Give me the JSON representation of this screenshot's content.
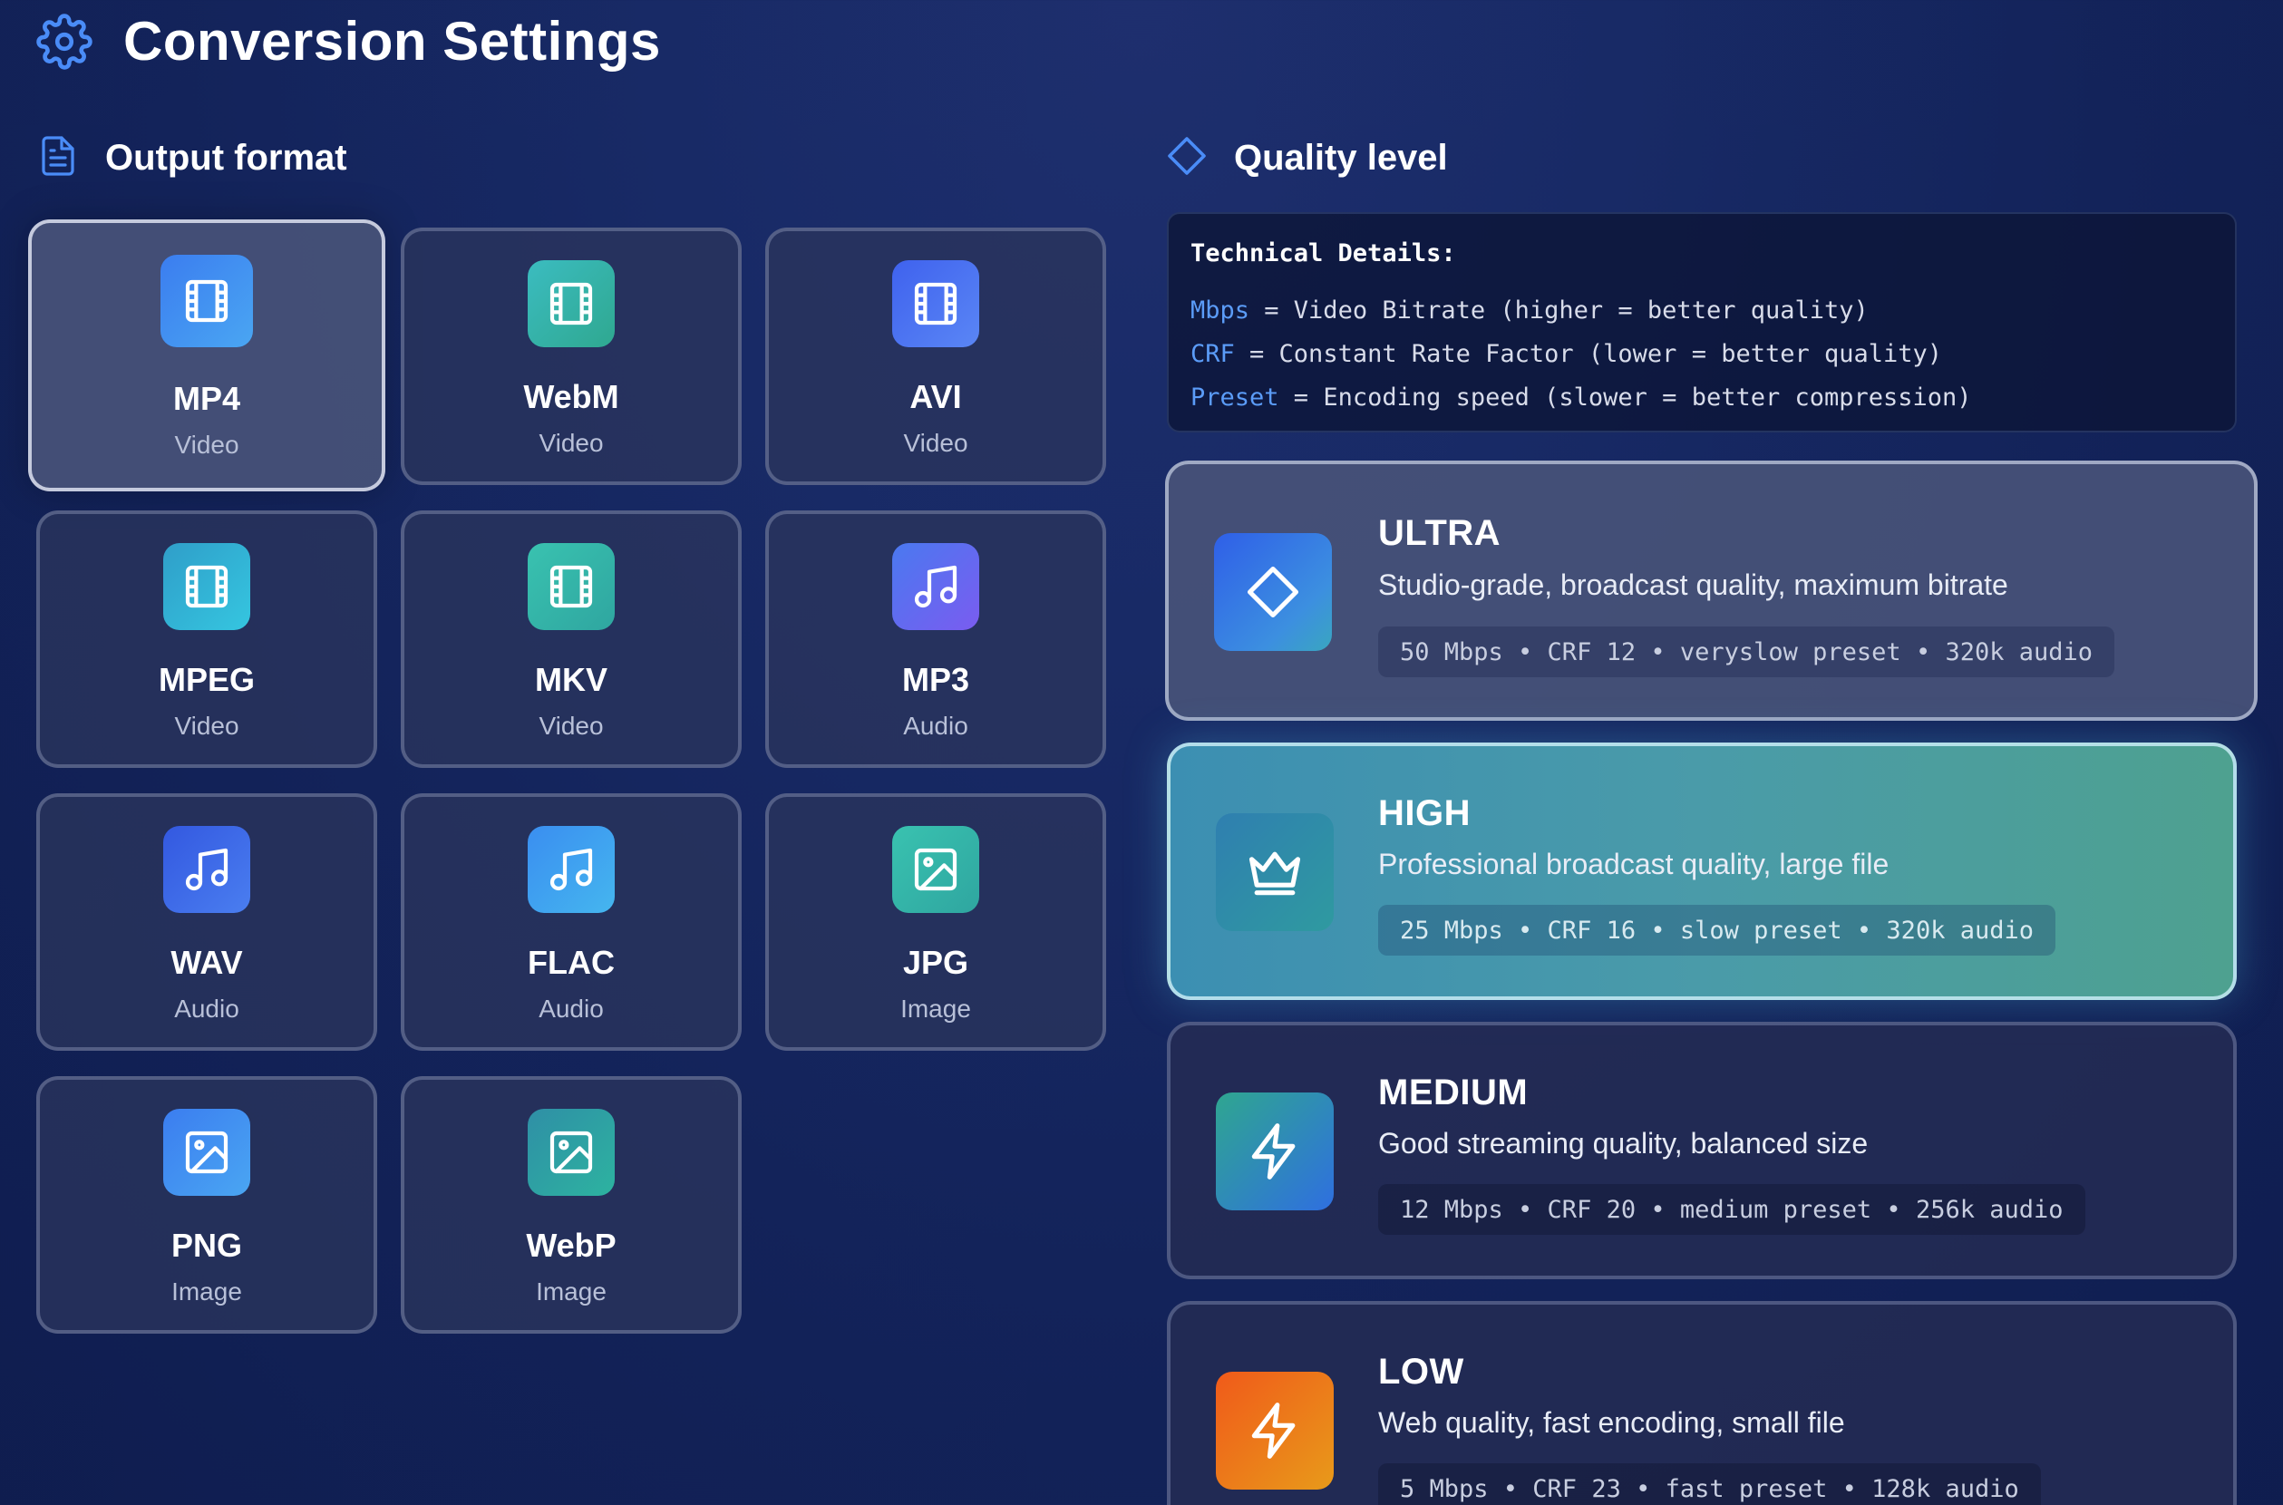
{
  "header": {
    "title": "Conversion Settings",
    "icon": "gear-icon"
  },
  "output_format": {
    "heading": "Output format",
    "icon": "document-icon",
    "selected": "MP4",
    "items": [
      {
        "name": "MP4",
        "type": "Video",
        "icon": "film-icon"
      },
      {
        "name": "WebM",
        "type": "Video",
        "icon": "film-icon"
      },
      {
        "name": "AVI",
        "type": "Video",
        "icon": "film-icon"
      },
      {
        "name": "MPEG",
        "type": "Video",
        "icon": "film-icon"
      },
      {
        "name": "MKV",
        "type": "Video",
        "icon": "film-icon"
      },
      {
        "name": "MP3",
        "type": "Audio",
        "icon": "music-note-icon"
      },
      {
        "name": "WAV",
        "type": "Audio",
        "icon": "music-note-icon"
      },
      {
        "name": "FLAC",
        "type": "Audio",
        "icon": "music-note-icon"
      },
      {
        "name": "JPG",
        "type": "Image",
        "icon": "image-icon"
      },
      {
        "name": "PNG",
        "type": "Image",
        "icon": "image-icon"
      },
      {
        "name": "WebP",
        "type": "Image",
        "icon": "image-icon"
      }
    ]
  },
  "quality_level": {
    "heading": "Quality level",
    "icon": "diamond-icon",
    "selected": "HIGH",
    "technical_details": {
      "title": "Technical Details:",
      "lines": [
        {
          "term": "Mbps",
          "text": " = Video Bitrate (higher = better quality)"
        },
        {
          "term": "CRF",
          "text": " = Constant Rate Factor (lower = better quality)"
        },
        {
          "term": "Preset",
          "text": " = Encoding speed (slower = better compression)"
        }
      ]
    },
    "options": [
      {
        "title": "ULTRA",
        "description": "Studio-grade, broadcast quality, maximum bitrate",
        "specs": "50 Mbps • CRF 12 • veryslow preset • 320k audio",
        "icon": "diamond-icon"
      },
      {
        "title": "HIGH",
        "description": "Professional broadcast quality, large file",
        "specs": "25 Mbps • CRF 16 • slow preset • 320k audio",
        "icon": "crown-icon"
      },
      {
        "title": "MEDIUM",
        "description": "Good streaming quality, balanced size",
        "specs": "12 Mbps • CRF 20 • medium preset • 256k audio",
        "icon": "lightning-icon"
      },
      {
        "title": "LOW",
        "description": "Web quality, fast encoding, small file",
        "specs": "5 Mbps • CRF 23 • fast preset • 128k audio",
        "icon": "lightning-icon"
      }
    ]
  },
  "colors": {
    "accent": "#4a8cf7",
    "background": "#152760",
    "selected_quality": "#4a9ba9",
    "low_icon": "#f05a1a"
  }
}
